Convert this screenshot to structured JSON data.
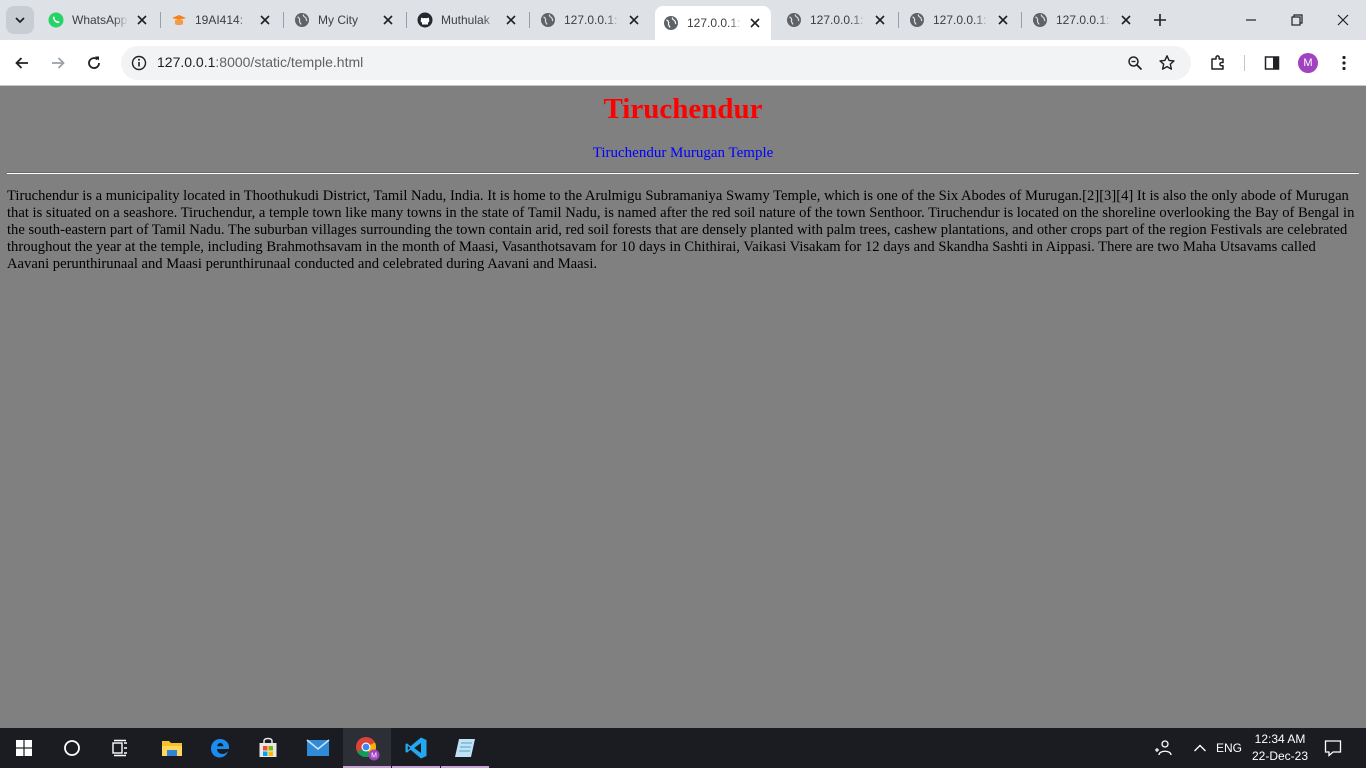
{
  "browser": {
    "tabs": [
      {
        "title": "WhatsApp",
        "favicon": "whatsapp-icon",
        "active": false
      },
      {
        "title": "19AI414: ",
        "favicon": "moodle-icon",
        "active": false
      },
      {
        "title": "My City",
        "favicon": "globe-icon",
        "active": false
      },
      {
        "title": "Muthulak",
        "favicon": "github-icon",
        "active": false
      },
      {
        "title": "127.0.0.1:",
        "favicon": "globe-icon",
        "active": false
      },
      {
        "title": "127.0.0.1:",
        "favicon": "globe-icon",
        "active": true
      },
      {
        "title": "127.0.0.1:",
        "favicon": "globe-icon",
        "active": false
      },
      {
        "title": "127.0.0.1:",
        "favicon": "globe-icon",
        "active": false
      },
      {
        "title": "127.0.0.1:",
        "favicon": "globe-icon",
        "active": false
      }
    ],
    "url_host": "127.0.0.1",
    "url_path": ":8000/static/temple.html",
    "profile_initial": "M"
  },
  "page": {
    "title": "Tiruchendur",
    "link_text": "Tiruchendur Murugan Temple",
    "paragraph": "Tiruchendur is a municipality located in Thoothukudi District, Tamil Nadu, India. It is home to the Arulmigu Subramaniya Swamy Temple, which is one of the Six Abodes of Murugan.[2][3][4] It is also the only abode of Murugan that is situated on a seashore. Tiruchendur, a temple town like many towns in the state of Tamil Nadu, is named after the red soil nature of the town Senthoor. Tiruchendur is located on the shoreline overlooking the Bay of Bengal in the south-eastern part of Tamil Nadu. The suburban villages surrounding the town contain arid, red soil forests that are densely planted with palm trees, cashew plantations, and other crops part of the region Festivals are celebrated throughout the year at the temple, including Brahmothsavam in the month of Maasi, Vasanthotsavam for 10 days in Chithirai, Vaikasi Visakam for 12 days and Skandha Sashti in Aippasi. There are two Maha Utsavams called Aavani perunthirunaal and Maasi perunthirunaal conducted and celebrated during Aavani and Maasi.",
    "colors": {
      "background": "#808080",
      "title": "#ff0000",
      "link": "#0000ff",
      "text": "#000000"
    }
  },
  "taskbar": {
    "language": "ENG",
    "time": "12:34 AM",
    "date": "22-Dec-23"
  }
}
